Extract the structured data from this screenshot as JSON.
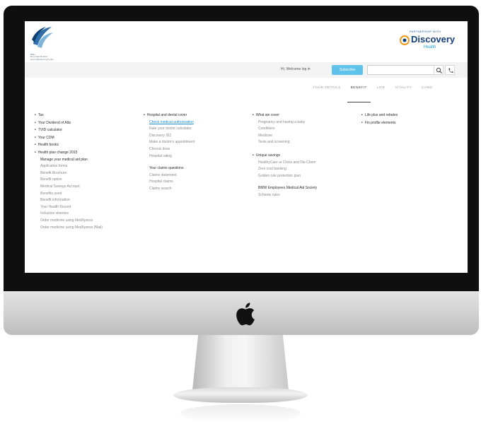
{
  "screen": {
    "logo_left": {
      "caption_lines": [
        "BMH",
        "Beverwijk Medical",
        "Gezondheidszorg Fonds"
      ]
    },
    "logo_right": {
      "kicker": "PARTNERSHIP WITH",
      "brand": "Discovery",
      "sub": "Health"
    },
    "utility_bar": {
      "member_text": "Hi, Welcome log in",
      "subscribe_label": "Subscribe",
      "search_placeholder": ""
    },
    "tabs": [
      {
        "label": "YOUR DETAILS",
        "active": false
      },
      {
        "label": "BENEFIT",
        "active": true
      },
      {
        "label": "LIFE",
        "active": false
      },
      {
        "label": "VITALITY",
        "active": false
      },
      {
        "label": "CARD",
        "active": false
      }
    ],
    "columns": [
      {
        "items": [
          {
            "text": "Tax",
            "kind": "top"
          },
          {
            "text": "Your Dividend of Alla",
            "kind": "top"
          },
          {
            "text": "TVID calculator",
            "kind": "top"
          },
          {
            "text": "Your CDM",
            "kind": "top"
          },
          {
            "text": "Health books",
            "kind": "top"
          },
          {
            "text": "Health plan change 2015",
            "kind": "top"
          },
          {
            "text": "Manage your medical aid plan",
            "kind": "heading"
          },
          {
            "text": "Application forms",
            "kind": "sub"
          },
          {
            "text": "Benefit Brochure",
            "kind": "sub"
          },
          {
            "text": "Benefit option",
            "kind": "sub"
          },
          {
            "text": "Medical Savings Account",
            "kind": "sub"
          },
          {
            "text": "Benefits used",
            "kind": "sub"
          },
          {
            "text": "Benefit information",
            "kind": "sub"
          },
          {
            "text": "Your Health Record",
            "kind": "sub"
          },
          {
            "text": "Induction vitamins",
            "kind": "sub"
          },
          {
            "text": "Order medicine using MedXpress",
            "kind": "sub"
          },
          {
            "text": "Order medicine using MedXpress (Mail)",
            "kind": "sub"
          }
        ]
      },
      {
        "items": [
          {
            "text": "Hospital and dental cover",
            "kind": "top"
          },
          {
            "text": "Check medical authorization",
            "kind": "link"
          },
          {
            "text": "Rate your doctor calculator",
            "kind": "sub"
          },
          {
            "text": "Discovery 911",
            "kind": "sub"
          },
          {
            "text": "Make a doctor's appointment",
            "kind": "sub"
          },
          {
            "text": "Chronic dose",
            "kind": "sub"
          },
          {
            "text": "Hospital rating",
            "kind": "sub"
          },
          {
            "text": "Your claims questions",
            "kind": "heading",
            "gap": true
          },
          {
            "text": "Claims statement",
            "kind": "sub"
          },
          {
            "text": "Hospital claims",
            "kind": "sub"
          },
          {
            "text": "Claims search",
            "kind": "sub"
          }
        ]
      },
      {
        "items": [
          {
            "text": "What we cover",
            "kind": "top"
          },
          {
            "text": "Pregnancy and having a baby",
            "kind": "sub"
          },
          {
            "text": "Conditions",
            "kind": "sub"
          },
          {
            "text": "Medicine",
            "kind": "sub"
          },
          {
            "text": "Tests and screening",
            "kind": "sub"
          },
          {
            "text": "Unique savings",
            "kind": "top",
            "gap": true
          },
          {
            "text": "HealthyCare at Clicks and Dis-Chem",
            "kind": "sub"
          },
          {
            "text": "Zero cost banking",
            "kind": "sub"
          },
          {
            "text": "Golden rule protection plan",
            "kind": "sub"
          },
          {
            "text": "BMW Employees Medical Aid Society",
            "kind": "heading",
            "gap": true
          },
          {
            "text": "Scheme rules",
            "kind": "sub"
          }
        ]
      },
      {
        "items": [
          {
            "text": "Life plus and rebates",
            "kind": "top"
          },
          {
            "text": "Fin profile elements",
            "kind": "top"
          }
        ]
      }
    ]
  },
  "colors": {
    "accent": "#5fc2e8",
    "link": "#1f8fcc",
    "brand": "#123f7a",
    "bezel": "#0f0f10"
  },
  "icons": [
    "search-icon",
    "phone-icon",
    "apple-icon"
  ]
}
